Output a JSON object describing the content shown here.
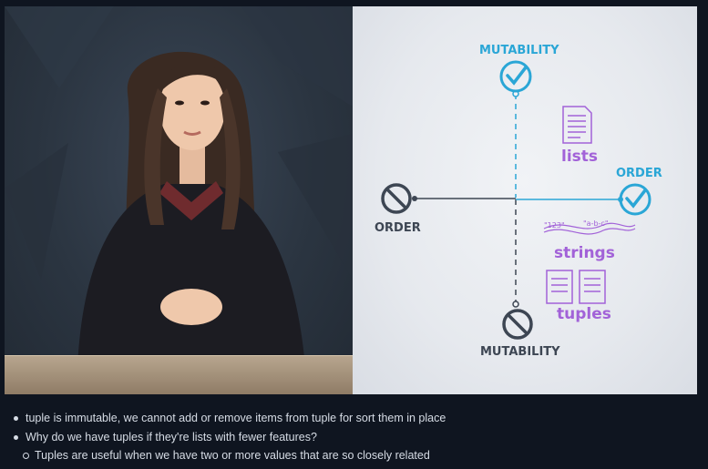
{
  "video": {
    "diagram": {
      "top_axis_label": "MUTABILITY",
      "bottom_axis_label": "MUTABILITY",
      "left_axis_label": "ORDER",
      "right_axis_label": "ORDER",
      "lists_label": "lists",
      "strings_label": "strings",
      "tuples_label": "tuples",
      "string_sample_1": "\"123\"",
      "string_sample_2": "\"a-b-c\"",
      "colors": {
        "accent_blue": "#2aa6d6",
        "purple": "#a262d8",
        "dark": "#3d4653"
      },
      "icons": [
        "check-circle-icon",
        "prohibited-circle-icon",
        "document-list-icon"
      ]
    }
  },
  "notes": {
    "bullets": [
      {
        "text": "tuple is immutable, we cannot add or remove items from tuple for sort them in place"
      },
      {
        "text": "Why do we have tuples if they're lists with fewer features?",
        "sub": [
          {
            "text": "Tuples are useful when we have two or more values that are so closely related"
          }
        ]
      }
    ]
  }
}
